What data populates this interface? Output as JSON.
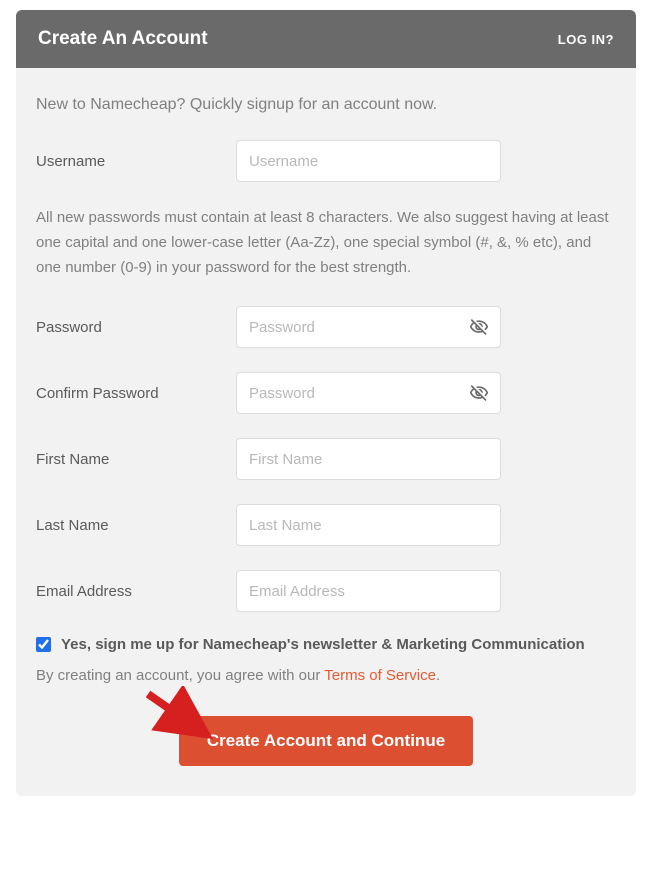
{
  "header": {
    "title": "Create An Account",
    "login_link": "LOG IN?"
  },
  "intro": "New to Namecheap? Quickly signup for an account now.",
  "password_hint": "All new passwords must contain at least 8 characters.\nWe also suggest having at least one capital and one lower-case letter (Aa-Zz), one special symbol (#, &, % etc), and one number (0-9) in your password for the best strength.",
  "fields": {
    "username": {
      "label": "Username",
      "placeholder": "Username"
    },
    "password": {
      "label": "Password",
      "placeholder": "Password"
    },
    "confirm_password": {
      "label": "Confirm Password",
      "placeholder": "Password"
    },
    "first_name": {
      "label": "First Name",
      "placeholder": "First Name"
    },
    "last_name": {
      "label": "Last Name",
      "placeholder": "Last Name"
    },
    "email": {
      "label": "Email Address",
      "placeholder": "Email Address"
    }
  },
  "newsletter": {
    "checked": true,
    "label": "Yes, sign me up for Namecheap's newsletter & Marketing Communication"
  },
  "terms": {
    "prefix": "By creating an account, you agree with our ",
    "link_text": "Terms of Service",
    "suffix": "."
  },
  "submit_label": "Create Account and Continue"
}
